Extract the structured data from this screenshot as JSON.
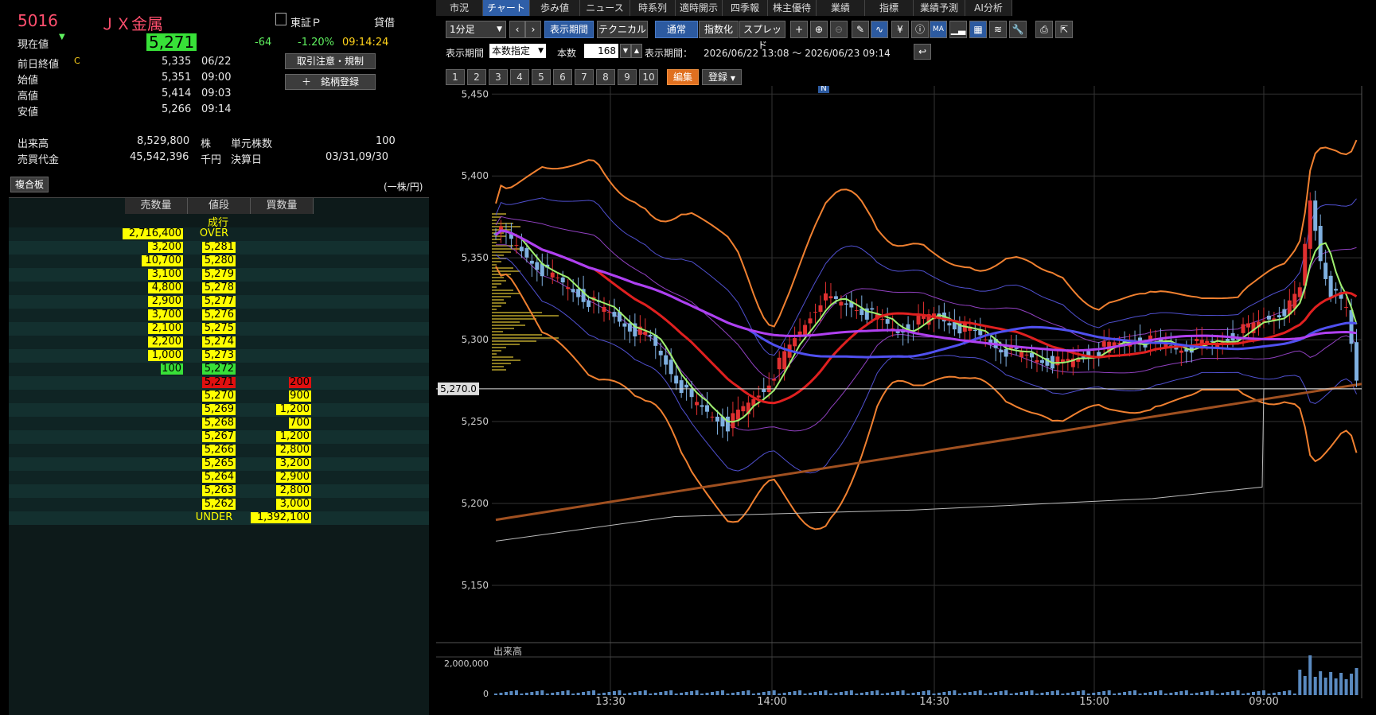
{
  "stock": {
    "code": "5016",
    "name": "ＪＸ金属",
    "market": "東証Ｐ",
    "margin": "貸借",
    "current_label": "現在値",
    "current_arrow": "▼",
    "current_price": "5,271",
    "change": "-64",
    "change_pct": "-1.20%",
    "time": "09:14:24",
    "prev_label": "前日終値",
    "prev_flag": "C",
    "prev_close": "5,335",
    "prev_date": "06/22",
    "open_label": "始値",
    "open": "5,351",
    "open_time": "09:00",
    "high_label": "高値",
    "high": "5,414",
    "high_time": "09:03",
    "low_label": "安値",
    "low": "5,266",
    "low_time": "09:14",
    "volume_label": "出来高",
    "volume": "8,529,800",
    "volume_unit": "株",
    "unit_label": "単元株数",
    "unit": "100",
    "turnover_label": "売買代金",
    "turnover": "45,542,396",
    "turnover_unit": "千円",
    "settle_label": "決算日",
    "settle": "03/31,09/30",
    "btn_notice": "取引注意・規制",
    "btn_register": "＋　銘柄登録",
    "board_tab": "複合板",
    "per_unit": "(一株/円)"
  },
  "board": {
    "headers": [
      "売数量",
      "値段",
      "買数量"
    ],
    "market_order": "成行",
    "rows": [
      {
        "sell": "2,716,400",
        "price": "OVER",
        "buy": ""
      },
      {
        "sell": "3,200",
        "price": "5,281",
        "buy": ""
      },
      {
        "sell": "10,700",
        "price": "5,280",
        "buy": ""
      },
      {
        "sell": "3,100",
        "price": "5,279",
        "buy": ""
      },
      {
        "sell": "4,800",
        "price": "5,278",
        "buy": ""
      },
      {
        "sell": "2,900",
        "price": "5,277",
        "buy": ""
      },
      {
        "sell": "3,700",
        "price": "5,276",
        "buy": ""
      },
      {
        "sell": "2,100",
        "price": "5,275",
        "buy": ""
      },
      {
        "sell": "2,200",
        "price": "5,274",
        "buy": ""
      },
      {
        "sell": "1,000",
        "price": "5,273",
        "buy": ""
      },
      {
        "sell": "100",
        "price": "5,272",
        "buy": ""
      },
      {
        "sell": "",
        "price": "5,271",
        "buy": "200"
      },
      {
        "sell": "",
        "price": "5,270",
        "buy": "900"
      },
      {
        "sell": "",
        "price": "5,269",
        "buy": "1,200"
      },
      {
        "sell": "",
        "price": "5,268",
        "buy": "700"
      },
      {
        "sell": "",
        "price": "5,267",
        "buy": "1,200"
      },
      {
        "sell": "",
        "price": "5,266",
        "buy": "2,800"
      },
      {
        "sell": "",
        "price": "5,265",
        "buy": "3,200"
      },
      {
        "sell": "",
        "price": "5,264",
        "buy": "2,900"
      },
      {
        "sell": "",
        "price": "5,263",
        "buy": "2,800"
      },
      {
        "sell": "",
        "price": "5,262",
        "buy": "3,000"
      },
      {
        "sell": "",
        "price": "UNDER",
        "buy": "1,392,100"
      }
    ]
  },
  "tabs": [
    "市況",
    "チャート",
    "歩み値",
    "ニュース",
    "時系列",
    "適時開示",
    "四季報",
    "株主優待",
    "業績",
    "指標",
    "業績予測",
    "AI分析"
  ],
  "toolbar": {
    "interval": "1分足",
    "period_btn": "表示期間",
    "tech_btn": "テクニカル",
    "normal_btn": "通常",
    "index_btn": "指数化",
    "spread_btn": "スプレッド",
    "period_label": "表示期間",
    "period_mode": "本数指定",
    "count_label": "本数",
    "count": "168",
    "range_label": "表示期間：",
    "range": "2026/06/22 13:08 ～ 2026/06/23 09:14",
    "numbers": [
      "1",
      "2",
      "3",
      "4",
      "5",
      "6",
      "7",
      "8",
      "9",
      "10"
    ],
    "edit_btn": "編集",
    "register_btn": "登録"
  },
  "chart_data": {
    "type": "candlestick",
    "ylim": [
      5115,
      5455
    ],
    "y_ticks": [
      "5,450",
      "5,400",
      "5,350",
      "5,300",
      "5,250",
      "5,200",
      "5,150"
    ],
    "x_ticks": [
      "13:30",
      "14:00",
      "14:30",
      "15:00",
      "09:00"
    ],
    "current_price_label": "5,270.0",
    "news_marker": "N",
    "volume_label": "出来高",
    "volume_tick": "2,000,000",
    "volume_zero": "0",
    "colors": {
      "up": "#e03030",
      "down": "#7fb0e0",
      "ma_short": "#a0f070",
      "ma_mid": "#e02020",
      "ma_long": "#5050f0",
      "ma_longer": "#b040f0",
      "bb": "#f08030",
      "vwap": "#a05020"
    }
  }
}
